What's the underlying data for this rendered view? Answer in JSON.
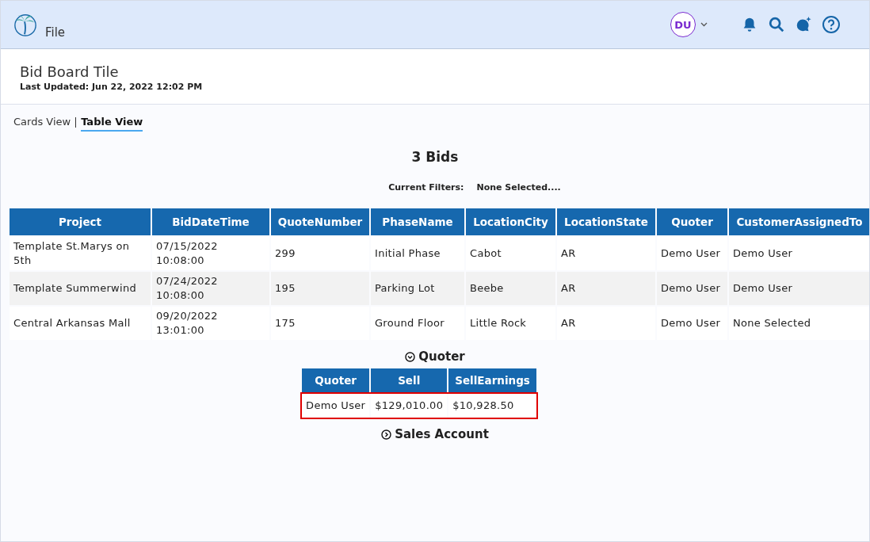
{
  "header": {
    "menu_label": "File",
    "avatar_initials": "DU"
  },
  "page": {
    "title": "Bid Board Tile",
    "last_updated": "Last Updated: Jun 22, 2022 12:02 PM"
  },
  "tabs": [
    {
      "label": "Cards View",
      "selected": false
    },
    {
      "label": "Table View",
      "selected": true
    }
  ],
  "bids_count": "3 Bids",
  "filters": {
    "label": "Current Filters:",
    "value": "None Selected...."
  },
  "table": {
    "columns": [
      "Project",
      "BidDateTime",
      "QuoteNumber",
      "PhaseName",
      "LocationCity",
      "LocationState",
      "Quoter",
      "CustomerAssignedTo"
    ],
    "rows": [
      [
        "Template St.Marys on 5th",
        "07/15/2022 10:08:00",
        "299",
        "Initial Phase",
        "Cabot",
        "AR",
        "Demo User",
        "Demo User"
      ],
      [
        "Template Summerwind",
        "07/24/2022 10:08:00",
        "195",
        "Parking Lot",
        "Beebe",
        "AR",
        "Demo User",
        "Demo User"
      ],
      [
        "Central Arkansas Mall",
        "09/20/2022 13:01:00",
        "175",
        "Ground Floor",
        "Little Rock",
        "AR",
        "Demo User",
        "None Selected"
      ]
    ]
  },
  "sections": [
    {
      "title": "Quoter",
      "expanded": true,
      "columns": [
        "Quoter",
        "Sell",
        "SellEarnings"
      ],
      "rows": [
        {
          "cells": [
            "Demo User",
            "$129,010.00",
            "$10,928.50"
          ],
          "highlighted": true
        }
      ]
    },
    {
      "title": "Sales Account",
      "expanded": false
    }
  ]
}
